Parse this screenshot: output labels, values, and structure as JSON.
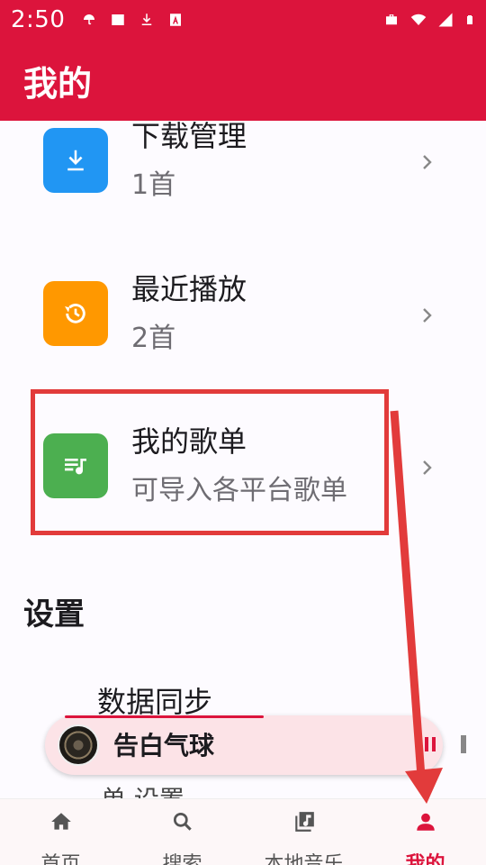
{
  "statusbar": {
    "time": "2:50",
    "left_icons": [
      "umbrella-icon",
      "image-icon",
      "download-icon",
      "text-a-icon"
    ],
    "right_icons": [
      "briefcase-icon",
      "wifi-icon",
      "signal-icon",
      "battery-icon"
    ]
  },
  "appbar": {
    "title": "我的"
  },
  "items": [
    {
      "title": "下载管理",
      "subtitle": "1首",
      "icon": "download-icon",
      "color": "#2196f3"
    },
    {
      "title": "最近播放",
      "subtitle": "2首",
      "icon": "history-icon",
      "color": "#ff9800"
    },
    {
      "title": "我的歌单",
      "subtitle": "可导入各平台歌单",
      "icon": "playlist-icon",
      "color": "#4caf50"
    }
  ],
  "settings": {
    "title": "设置",
    "sync": "数据同步",
    "next": "单 设置"
  },
  "player": {
    "song": "告白气球",
    "progress": 0.5
  },
  "nav": [
    {
      "label": "首页",
      "icon": "home-icon"
    },
    {
      "label": "搜索",
      "icon": "search-icon"
    },
    {
      "label": "本地音乐",
      "icon": "library-music-icon"
    },
    {
      "label": "我的",
      "icon": "person-icon",
      "active": true
    }
  ],
  "colors": {
    "accent": "#dc143c",
    "annotation": "#e23b3b"
  }
}
